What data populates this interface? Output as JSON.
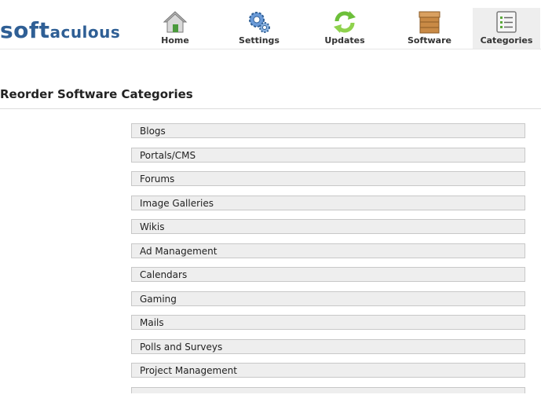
{
  "logo": {
    "part1": "soft",
    "part2": "aculous"
  },
  "nav": [
    {
      "label": "Home",
      "icon": "home-icon"
    },
    {
      "label": "Settings",
      "icon": "settings-gears-icon"
    },
    {
      "label": "Updates",
      "icon": "updates-arrows-icon"
    },
    {
      "label": "Software",
      "icon": "software-box-icon"
    },
    {
      "label": "Categories",
      "icon": "categories-list-icon"
    }
  ],
  "active_nav": "Categories",
  "page": {
    "title": "Reorder Software Categories"
  },
  "categories": [
    "Blogs",
    "Portals/CMS",
    "Forums",
    "Image Galleries",
    "Wikis",
    "Ad Management",
    "Calendars",
    "Gaming",
    "Mails",
    "Polls and Surveys",
    "Project Management"
  ],
  "colors": {
    "logo": "#2f5f95",
    "active_tab": "#eeeeee",
    "row_bg": "#eeeeee",
    "row_border": "#c8c8c8"
  }
}
